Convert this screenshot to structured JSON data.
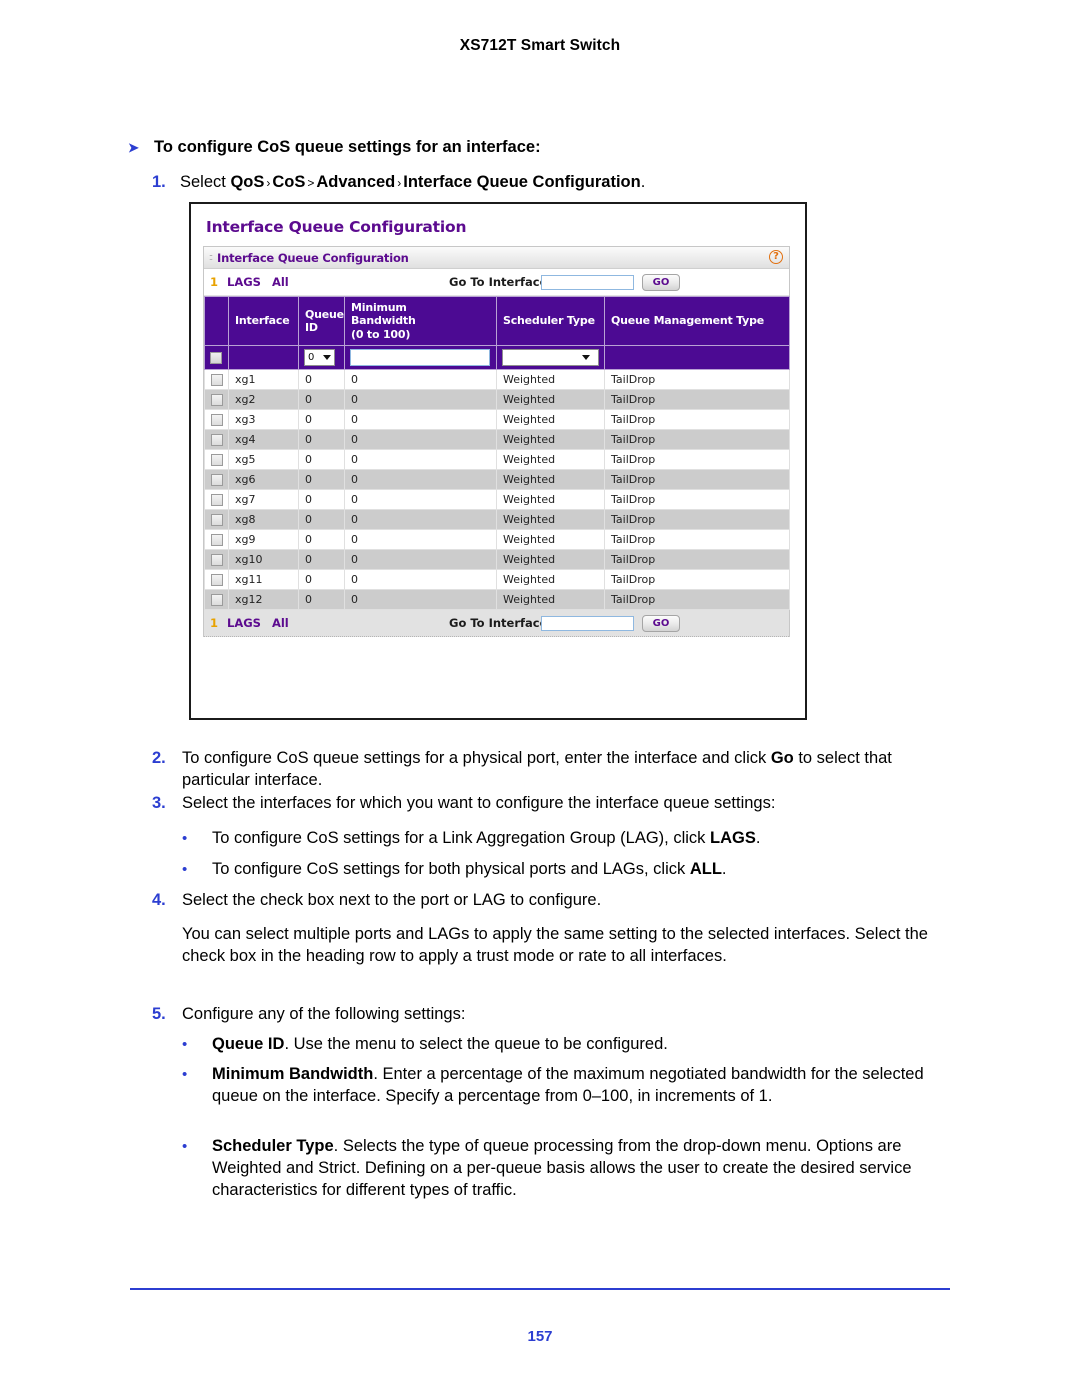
{
  "running_head": "XS712T Smart Switch",
  "procedure": {
    "arrow_glyph": "➤",
    "heading": "To configure CoS queue settings for an interface:",
    "step1": {
      "num": "1.",
      "lead": "Select ",
      "path": [
        "QoS",
        "CoS",
        "Advanced",
        "Interface Queue Configuration"
      ],
      "sep1": "›",
      "sep2": ">",
      "sep3": "›",
      "trailing": "."
    }
  },
  "screenshot": {
    "title": "Interface Queue Configuration",
    "panel_bar": {
      "title": "Interface Queue Configuration",
      "grip_glyph": "::",
      "help_glyph": "?"
    },
    "toolbar_top": {
      "index": "1",
      "lags_label": "LAGS",
      "all_label": "All",
      "goto_label": "Go To Interface",
      "goto_value": "",
      "goto_placeholder": "",
      "go_button": "GO"
    },
    "toolbar_bottom": {
      "index": "1",
      "lags_label": "LAGS",
      "all_label": "All",
      "goto_label": "Go To Interface",
      "goto_value": "",
      "goto_placeholder": "",
      "go_button": "GO"
    },
    "columns": [
      "",
      "Interface",
      "Queue ID",
      "Minimum Bandwidth (0 to 100)",
      "Scheduler Type",
      "Queue Management Type"
    ],
    "column_lines": {
      "interface": "Interface",
      "queue_id_l1": "Queue",
      "queue_id_l2": "ID",
      "bandwidth_l1": "Minimum",
      "bandwidth_l2": "Bandwidth",
      "bandwidth_l3": "(0 to 100)",
      "scheduler": "Scheduler Type",
      "queue_mgmt": "Queue Management Type"
    },
    "edit_row": {
      "queue_id_value": "0",
      "bandwidth_value": "",
      "scheduler_value": ""
    },
    "rows": [
      {
        "interface": "xg1",
        "queue_id": "0",
        "bandwidth": "0",
        "scheduler": "Weighted",
        "queue_mgmt": "TailDrop"
      },
      {
        "interface": "xg2",
        "queue_id": "0",
        "bandwidth": "0",
        "scheduler": "Weighted",
        "queue_mgmt": "TailDrop"
      },
      {
        "interface": "xg3",
        "queue_id": "0",
        "bandwidth": "0",
        "scheduler": "Weighted",
        "queue_mgmt": "TailDrop"
      },
      {
        "interface": "xg4",
        "queue_id": "0",
        "bandwidth": "0",
        "scheduler": "Weighted",
        "queue_mgmt": "TailDrop"
      },
      {
        "interface": "xg5",
        "queue_id": "0",
        "bandwidth": "0",
        "scheduler": "Weighted",
        "queue_mgmt": "TailDrop"
      },
      {
        "interface": "xg6",
        "queue_id": "0",
        "bandwidth": "0",
        "scheduler": "Weighted",
        "queue_mgmt": "TailDrop"
      },
      {
        "interface": "xg7",
        "queue_id": "0",
        "bandwidth": "0",
        "scheduler": "Weighted",
        "queue_mgmt": "TailDrop"
      },
      {
        "interface": "xg8",
        "queue_id": "0",
        "bandwidth": "0",
        "scheduler": "Weighted",
        "queue_mgmt": "TailDrop"
      },
      {
        "interface": "xg9",
        "queue_id": "0",
        "bandwidth": "0",
        "scheduler": "Weighted",
        "queue_mgmt": "TailDrop"
      },
      {
        "interface": "xg10",
        "queue_id": "0",
        "bandwidth": "0",
        "scheduler": "Weighted",
        "queue_mgmt": "TailDrop"
      },
      {
        "interface": "xg11",
        "queue_id": "0",
        "bandwidth": "0",
        "scheduler": "Weighted",
        "queue_mgmt": "TailDrop"
      },
      {
        "interface": "xg12",
        "queue_id": "0",
        "bandwidth": "0",
        "scheduler": "Weighted",
        "queue_mgmt": "TailDrop"
      }
    ]
  },
  "steps": {
    "step2": {
      "num": "2.",
      "part1": "To configure CoS queue settings for a physical port, enter the interface and click ",
      "bold": "Go",
      "part2": " to select that particular interface."
    },
    "step3": {
      "num": "3.",
      "text": "Select the interfaces for which you want to configure the interface queue settings:"
    },
    "bullet_lags": {
      "dot": "•",
      "part1": "To configure CoS settings for a Link Aggregation Group (LAG), click ",
      "bold": "LAGS",
      "part2": "."
    },
    "bullet_all": {
      "dot": "•",
      "part1": "To configure CoS settings for both physical ports and LAGs, click ",
      "bold": "ALL",
      "part2": "."
    },
    "step4": {
      "num": "4.",
      "text": "Select the check box next to the port or LAG to configure."
    },
    "para_multi": "You can select multiple ports and LAGs to apply the same setting to the selected interfaces. Select the check box in the heading row to apply a trust mode or rate to all interfaces.",
    "step5": {
      "num": "5.",
      "text": "Configure any of the following settings:"
    },
    "bullet_queue_id": {
      "dot": "•",
      "bold": "Queue ID",
      "text": ". Use the menu to select the queue to be configured."
    },
    "bullet_min_bw": {
      "dot": "•",
      "bold": "Minimum Bandwidth",
      "text": ". Enter a percentage of the maximum negotiated bandwidth for the selected queue on the interface. Specify a percentage from 0–100, in increments of 1."
    },
    "bullet_sched": {
      "dot": "•",
      "bold": "Scheduler Type",
      "text": ". Selects the type of queue processing from the drop-down menu. Options are Weighted and Strict. Defining on a per-queue basis allows the user to create the desired service characteristics for different types of traffic."
    }
  },
  "footer": {
    "page_number": "157"
  },
  "colors": {
    "accent_blue": "#2c3ed1",
    "header_purple": "#4c0a93",
    "title_purple": "#5c0b8f",
    "lags_gold": "#e8a200",
    "help_orange": "#e2700f",
    "row_alt_gray": "#cccccc"
  }
}
